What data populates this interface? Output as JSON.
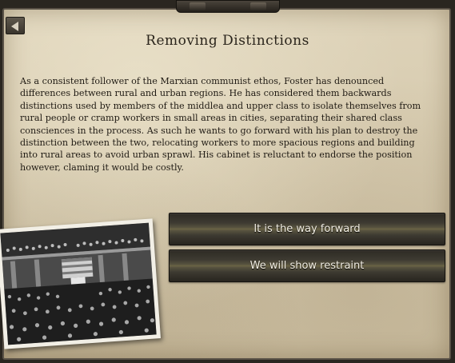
{
  "event": {
    "title": "Removing Distinctions",
    "description": "As a consistent follower of the Marxian communist ethos, Foster has denounced differences between rural and urban regions. He has considered them backwards distinctions used by members of the middlea and upper class to isolate themselves from rural people or cramp workers in small areas in cities, separating their shared class consciences in the process. As such he wants to go forward with his plan to destroy the distinction between the two, relocating workers to more spacious regions and building into rural areas to avoid urban sprawl.  His cabinet is reluctant to endorse the position however, claming it would be costly."
  },
  "options": [
    {
      "label": "It is the way forward"
    },
    {
      "label": "We will show restraint"
    }
  ],
  "icons": {
    "back": "back-arrow-icon"
  }
}
